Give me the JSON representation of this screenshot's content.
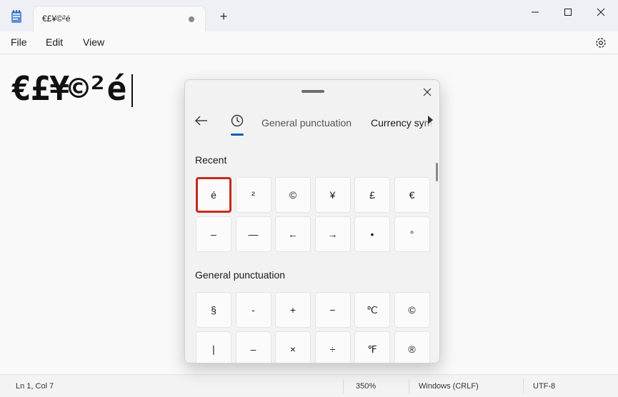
{
  "window": {
    "tab_title": "€£¥©²é",
    "new_tab": "+",
    "minimize": "minimize-icon",
    "maximize": "maximize-icon",
    "close": "close-icon"
  },
  "menu": {
    "items": [
      "File",
      "Edit",
      "View"
    ],
    "settings_icon": "gear-icon"
  },
  "editor": {
    "text": "€£¥©²é"
  },
  "status_bar": {
    "position": "Ln 1, Col 7",
    "zoom": "350%",
    "line_ending": "Windows (CRLF)",
    "encoding": "UTF-8"
  },
  "symbol_panel": {
    "tabs": {
      "back_icon": "back-arrow-icon",
      "recent_icon": "clock-icon",
      "general": "General punctuation",
      "currency": "Currency symb"
    },
    "sections": [
      {
        "title": "Recent",
        "rows": [
          [
            "é",
            "²",
            "©",
            "¥",
            "£",
            "€"
          ],
          [
            "–",
            "—",
            "←",
            "→",
            "•",
            "°"
          ]
        ],
        "selected": "é"
      },
      {
        "title": "General punctuation",
        "rows": [
          [
            "§",
            "-",
            "+",
            "−",
            "℃",
            "©"
          ],
          [
            "|",
            "–",
            "×",
            "÷",
            "℉",
            "®"
          ]
        ]
      }
    ]
  },
  "colors": {
    "accent": "#0a5fb4",
    "selection_border": "#c42b1c"
  }
}
